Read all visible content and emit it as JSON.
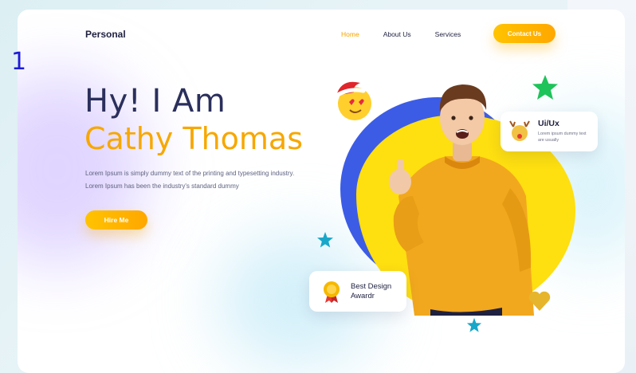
{
  "overlay": {
    "page_marker": "1"
  },
  "side_fragment": {
    "text": "(\n·"
  },
  "header": {
    "brand": "Personal",
    "nav": [
      {
        "label": "Home",
        "active": true
      },
      {
        "label": "About Us",
        "active": false
      },
      {
        "label": "Services",
        "active": false
      }
    ],
    "cta_label": "Contact Us"
  },
  "hero": {
    "line1": "Hy! I Am",
    "line2": "Cathy Thomas",
    "description_line1": "Lorem Ipsum is simply dummy text of the printing and typesetting industry.",
    "description_line2": "Lorem Ipsum has been the industry's standard dummy",
    "hire_label": "Hire Me"
  },
  "badges": {
    "uiux": {
      "title": "Ui/Ux",
      "subtitle": "Lorem ipsum dummy text are usually"
    },
    "award": {
      "title": "Best Design Awardr"
    }
  },
  "colors": {
    "accent": "#f7a700",
    "heading": "#2b2f5c",
    "blob_blue": "#3c5ce6",
    "blob_yellow": "#fedf10",
    "sweater": "#f2a81e",
    "marker_blue": "#1b1bd6"
  },
  "icons": [
    "santa-hat-heart-eyes-emoji-icon",
    "green-star-icon",
    "blue-star-icon",
    "gold-heart-icon",
    "reindeer-icon",
    "award-medal-icon"
  ]
}
